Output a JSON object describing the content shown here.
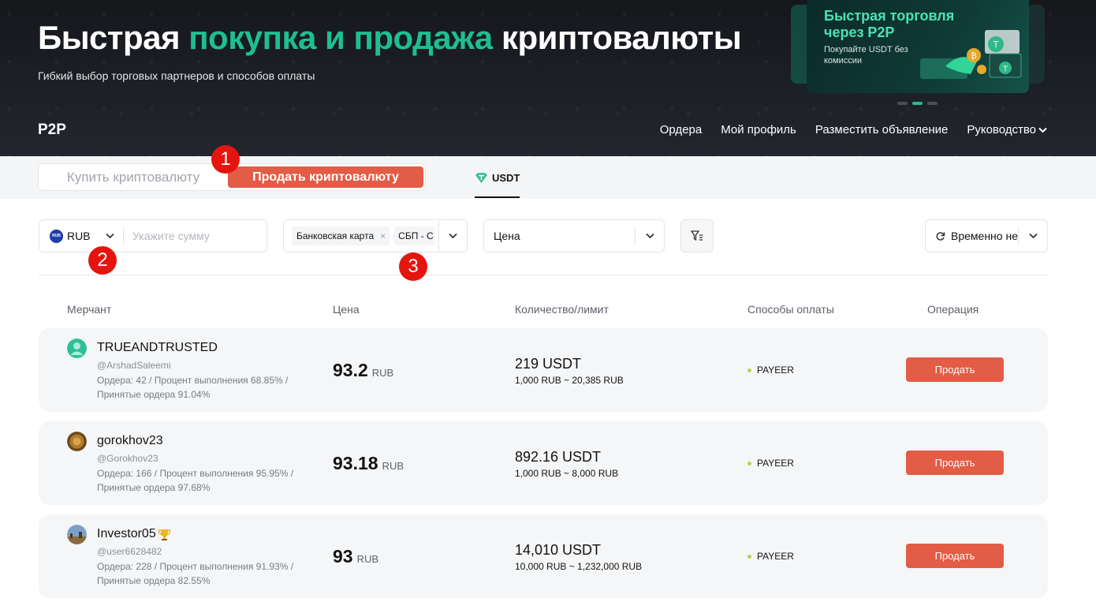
{
  "hero": {
    "title_part1": "Быстрая ",
    "title_accent": "покупка и продажа",
    "title_part2": " криптовалюты",
    "subtitle": "Гибкий выбор торговых партнеров и способов оплаты",
    "banner_title": "Быстрая торговля через P2P",
    "banner_text": "Покупайте USDT без комиссии"
  },
  "nav": {
    "logo": "P2P",
    "items": [
      "Ордера",
      "Мой профиль",
      "Разместить объявление",
      "Руководство"
    ]
  },
  "tabs": {
    "buy": "Купить криптовалюту",
    "sell": "Продать криптовалюту",
    "coin": "USDT"
  },
  "filters": {
    "currency": "RUB",
    "currency_flag": "RUB",
    "amount_placeholder": "Укажите сумму",
    "payment_chip1": "Банковская карта",
    "payment_chip2": "СБП - С",
    "price_label": "Цена",
    "time_label": "Временно не"
  },
  "table": {
    "headers": {
      "merchant": "Мерчант",
      "price": "Цена",
      "quantity": "Количество/лимит",
      "payment": "Способы оплаты",
      "operation": "Операция"
    },
    "rows": [
      {
        "name": "TRUEANDTRUSTED",
        "handle": "@ArshadSaleemi",
        "stats": "Ордера: 42 / Процент выполнения 68.85% / Принятые ордера 91.04%",
        "price": "93.2",
        "currency": "RUB",
        "quantity": "219 USDT",
        "limit": "1,000 RUB ~ 20,385 RUB",
        "payment": "PAYEER",
        "action": "Продать"
      },
      {
        "name": "gorokhov23",
        "handle": "@Gorokhov23",
        "stats": "Ордера: 166 / Процент выполнения 95.95% / Принятые ордера 97.68%",
        "price": "93.18",
        "currency": "RUB",
        "quantity": "892.16 USDT",
        "limit": "1,000 RUB ~ 8,000 RUB",
        "payment": "PAYEER",
        "action": "Продать"
      },
      {
        "name": "Investor05",
        "handle": "@user6628482",
        "stats": "Ордера: 228 / Процент выполнения 91.93% / Принятые ордера 82.55%",
        "price": "93",
        "currency": "RUB",
        "quantity": "14,010 USDT",
        "limit": "10,000 RUB ~ 1,232,000 RUB",
        "payment": "PAYEER",
        "action": "Продать"
      }
    ]
  },
  "markers": [
    "1",
    "2",
    "3"
  ],
  "colors": {
    "accent_green": "#1dbf8f",
    "sell_red": "#e25c46",
    "marker_red": "#e5140f"
  }
}
